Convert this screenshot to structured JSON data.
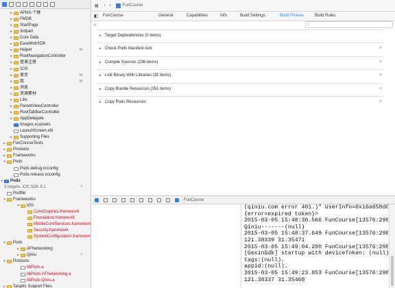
{
  "navigator": {
    "rows": [
      {
        "label": "APNS-个推",
        "t": "▸",
        "icon": "fold",
        "ind": 14,
        "red": false,
        "badge": ""
      },
      {
        "label": "FMDB",
        "t": "▸",
        "icon": "fold",
        "ind": 14,
        "red": false,
        "badge": ""
      },
      {
        "label": "StartPage",
        "t": "▸",
        "icon": "fold",
        "ind": 14,
        "red": false,
        "badge": ""
      },
      {
        "label": "3rdpart",
        "t": "▸",
        "icon": "fold",
        "ind": 14,
        "red": false,
        "badge": ""
      },
      {
        "label": "Core Data",
        "t": "▸",
        "icon": "fold",
        "ind": 14,
        "red": false,
        "badge": ""
      },
      {
        "label": "EaseMobSDK",
        "t": "▸",
        "icon": "fold",
        "ind": 14,
        "red": false,
        "badge": ""
      },
      {
        "label": "Helper",
        "t": "▸",
        "icon": "fold",
        "ind": 14,
        "red": false,
        "badge": "M"
      },
      {
        "label": "RootNavigationController",
        "t": "▸",
        "icon": "fold",
        "ind": 14,
        "red": false,
        "badge": ""
      },
      {
        "label": "登录注册",
        "t": "▸",
        "icon": "fold",
        "ind": 14,
        "red": false,
        "badge": ""
      },
      {
        "label": "公众",
        "t": "▸",
        "icon": "fold",
        "ind": 14,
        "red": false,
        "badge": ""
      },
      {
        "label": "首页",
        "t": "▸",
        "icon": "fold",
        "ind": 14,
        "red": false,
        "badge": "M"
      },
      {
        "label": "我",
        "t": "▸",
        "icon": "fold",
        "ind": 14,
        "red": false,
        "badge": "M"
      },
      {
        "label": "消息",
        "t": "▸",
        "icon": "fold",
        "ind": 14,
        "red": false,
        "badge": ""
      },
      {
        "label": "资源素材",
        "t": "▸",
        "icon": "fold",
        "ind": 14,
        "red": false,
        "badge": ""
      },
      {
        "label": "Libs",
        "t": "▸",
        "icon": "fold",
        "ind": 14,
        "red": false,
        "badge": ""
      },
      {
        "label": "ParentViewController",
        "t": "▸",
        "icon": "fold",
        "ind": 14,
        "red": false,
        "badge": ""
      },
      {
        "label": "RootTabBarController",
        "t": "▸",
        "icon": "fold",
        "ind": 14,
        "red": false,
        "badge": ""
      },
      {
        "label": "AppDelegate",
        "t": "▸",
        "icon": "fold",
        "ind": 14,
        "red": false,
        "badge": ""
      },
      {
        "label": "Images.xcassets",
        "t": "",
        "icon": "xcas",
        "ind": 14,
        "red": false,
        "badge": ""
      },
      {
        "label": "LaunchScreen.xib",
        "t": "",
        "icon": "file",
        "ind": 14,
        "red": false,
        "badge": ""
      },
      {
        "label": "Supporting Files",
        "t": "▸",
        "icon": "fold",
        "ind": 14,
        "red": false,
        "badge": ""
      },
      {
        "label": "FunCourseTests",
        "t": "▸",
        "icon": "fold",
        "ind": 4,
        "red": false,
        "badge": ""
      },
      {
        "label": "Products",
        "t": "▸",
        "icon": "fold",
        "ind": 4,
        "red": false,
        "badge": ""
      },
      {
        "label": "Frameworks",
        "t": "▸",
        "icon": "fold",
        "ind": 4,
        "red": false,
        "badge": ""
      },
      {
        "label": "Pods",
        "t": "▾",
        "icon": "fold",
        "ind": 4,
        "red": false,
        "badge": ""
      },
      {
        "label": "Pods.debug.xcconfig",
        "t": "",
        "icon": "file",
        "ind": 14,
        "red": false,
        "badge": ""
      },
      {
        "label": "Pods.release.xcconfig",
        "t": "",
        "icon": "file",
        "ind": 14,
        "red": false,
        "badge": ""
      },
      {
        "label": "Pods",
        "t": "▾",
        "icon": "proj",
        "ind": 0,
        "red": false,
        "badge": "",
        "bold": true
      },
      {
        "label": "3 targets, iOS SDK 8.1",
        "t": "",
        "icon": "none",
        "ind": 0,
        "red": false,
        "badge": "?",
        "sub": true
      },
      {
        "label": "Podfile",
        "t": "",
        "icon": "file",
        "ind": 4,
        "red": false,
        "badge": ""
      },
      {
        "label": "Frameworks",
        "t": "▾",
        "icon": "fold",
        "ind": 4,
        "red": false,
        "badge": ""
      },
      {
        "label": "iOS",
        "t": "▾",
        "icon": "fold",
        "ind": 24,
        "red": false,
        "badge": ""
      },
      {
        "label": "CoreGraphics.framework",
        "t": "",
        "icon": "fold",
        "ind": 34,
        "red": true,
        "badge": ""
      },
      {
        "label": "Foundation.framework",
        "t": "",
        "icon": "fold",
        "ind": 34,
        "red": true,
        "badge": ""
      },
      {
        "label": "MobileCoreServices.framework",
        "t": "",
        "icon": "fold",
        "ind": 34,
        "red": true,
        "badge": ""
      },
      {
        "label": "Security.framework",
        "t": "",
        "icon": "fold",
        "ind": 34,
        "red": true,
        "badge": ""
      },
      {
        "label": "SystemConfiguration.framework",
        "t": "",
        "icon": "fold",
        "ind": 34,
        "red": true,
        "badge": ""
      },
      {
        "label": "Pods",
        "t": "▾",
        "icon": "fold",
        "ind": 4,
        "red": false,
        "badge": ""
      },
      {
        "label": "AFNetworking",
        "t": "▸",
        "icon": "fold",
        "ind": 24,
        "red": false,
        "badge": ""
      },
      {
        "label": "Qiniu",
        "t": "▸",
        "icon": "fold",
        "ind": 24,
        "red": false,
        "badge": "?"
      },
      {
        "label": "Products",
        "t": "▾",
        "icon": "fold",
        "ind": 4,
        "red": false,
        "badge": ""
      },
      {
        "label": "libPods.a",
        "t": "",
        "icon": "file",
        "ind": 24,
        "red": true,
        "badge": ""
      },
      {
        "label": "libPods-AFNetworking.a",
        "t": "",
        "icon": "file",
        "ind": 24,
        "red": true,
        "badge": ""
      },
      {
        "label": "libPods-Qiniu.a",
        "t": "",
        "icon": "file",
        "ind": 24,
        "red": true,
        "badge": ""
      },
      {
        "label": "Targets Support Files",
        "t": "▸",
        "icon": "fold",
        "ind": 4,
        "red": false,
        "badge": ""
      }
    ]
  },
  "jumpbar": {
    "file": "FunCourse"
  },
  "tabs": {
    "target": "FunCourse",
    "items": [
      "General",
      "Capabilities",
      "Info",
      "Build Settings",
      "Build Phases",
      "Build Rules"
    ],
    "active": "Build Phases"
  },
  "search": {
    "placeholder": ""
  },
  "phases": [
    {
      "label": "Target Dependencies (0 items)",
      "close": false
    },
    {
      "label": "Check Pods Manifest.lock",
      "close": true
    },
    {
      "label": "Compile Sources (236 items)",
      "close": true
    },
    {
      "label": "Link Binary With Libraries (32 items)",
      "close": true
    },
    {
      "label": "Copy Bundle Resources (351 items)",
      "close": true
    },
    {
      "label": "Copy Pods Resources",
      "close": true
    }
  ],
  "debugbar": {
    "target": "FunCourse"
  },
  "console": {
    "lines": [
      "(qiniu.com error 401.)\" UserInfo=0x16a658d0",
      "{error=expired token}>",
      "2015-03-05 15:48:30.566 FunCourse[13576:2983503]",
      "Qiniu-------(null)",
      "2015-03-05 15:48:37.649 FunCourse[13576:2983503]",
      "121.38339 31.35471",
      "2015-03-05 15:49:04.200 FunCourse[13576:2983503]",
      "[GexinSdk] startup with deviceToken: (null)",
      "tags:(null),",
      "appid:(null).",
      "2015-03-05 15:49:23.853 FunCourse[13576:2983503]",
      "121.38337 31.35468"
    ]
  },
  "colors": {
    "accent": "#2f7fe6",
    "missing": "#d0021b"
  }
}
